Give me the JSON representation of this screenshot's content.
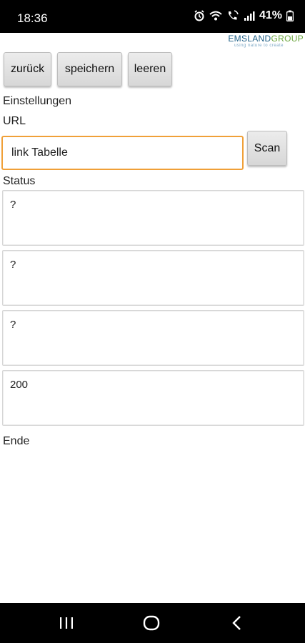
{
  "status_bar": {
    "time": "18:36",
    "battery": "41%",
    "icons": [
      "alarm-icon",
      "wifi-icon",
      "call-icon",
      "signal-icon",
      "battery-icon"
    ]
  },
  "logo": {
    "name_part1": "EMSLAND",
    "name_part2": "GROUP",
    "tagline": "using nature to create"
  },
  "toolbar": {
    "back_label": "zurück",
    "save_label": "speichern",
    "clear_label": "leeren"
  },
  "form": {
    "settings_label": "Einstellungen",
    "url_label": "URL",
    "url_value": "link Tabelle",
    "scan_label": "Scan",
    "status_label": "Status",
    "status_values": [
      "?",
      "?",
      "?",
      "200"
    ],
    "end_label": "Ende"
  },
  "nav_bar": {
    "icons": [
      "recents-icon",
      "home-icon",
      "back-icon"
    ]
  },
  "colors": {
    "input_focus_border": "#f0a038",
    "logo_blue": "#1f5f86",
    "logo_green": "#6aa53c"
  }
}
